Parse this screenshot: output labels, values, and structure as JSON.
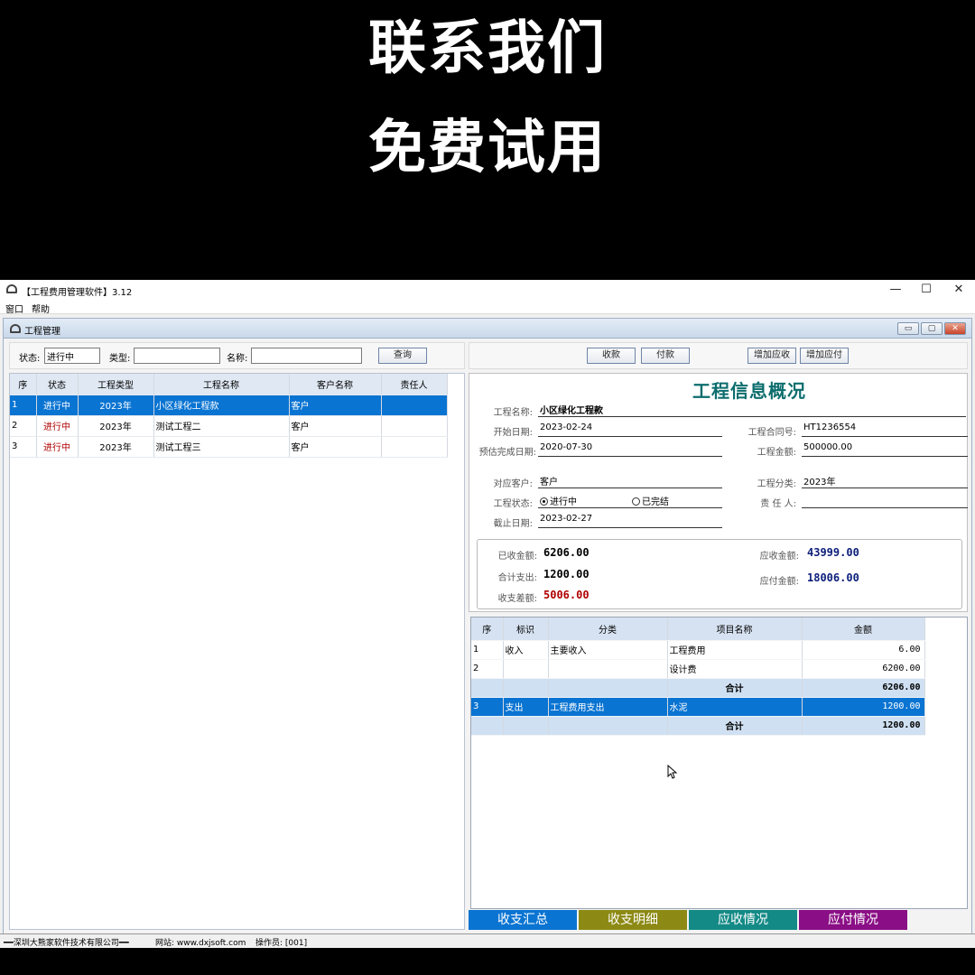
{
  "banner": {
    "line1": "联系我们",
    "line2": "免费试用"
  },
  "window": {
    "title": "【工程费用管理软件】3.12",
    "minimize": "—",
    "maximize": "☐",
    "close": "✕"
  },
  "menu": {
    "items": [
      "窗口",
      "帮助"
    ]
  },
  "child": {
    "title": "工程管理",
    "min": "▭",
    "max": "▢",
    "close": "✕"
  },
  "filter": {
    "status_label": "状态:",
    "status_value": "进行中",
    "type_label": "类型:",
    "type_value": "",
    "name_label": "名称:",
    "name_value": "",
    "query_button": "查询"
  },
  "actions": {
    "receive": "收款",
    "pay": "付款",
    "add_receivable": "增加应收",
    "add_payable": "增加应付"
  },
  "project_grid": {
    "columns": [
      "序",
      "状态",
      "工程类型",
      "工程名称",
      "客户名称",
      "责任人"
    ],
    "rows": [
      {
        "no": "1",
        "status": "进行中",
        "type": "2023年",
        "name": "小区绿化工程款",
        "client": "客户",
        "owner": ""
      },
      {
        "no": "2",
        "status": "进行中",
        "type": "2023年",
        "name": "测试工程二",
        "client": "客户",
        "owner": ""
      },
      {
        "no": "3",
        "status": "进行中",
        "type": "2023年",
        "name": "测试工程三",
        "client": "客户",
        "owner": ""
      }
    ]
  },
  "info": {
    "heading": "工程信息概况",
    "name_label": "工程名称:",
    "name": "小区绿化工程款",
    "start_label": "开始日期:",
    "start": "2023-02-24",
    "contract_label": "工程合同号:",
    "contract": "HT1236554",
    "due_label": "预估完成日期:",
    "due": "2020-07-30",
    "amount_label": "工程金额:",
    "amount": "500000.00",
    "client_label": "对应客户:",
    "client": "客户",
    "category_label": "工程分类:",
    "category": "2023年",
    "state_label": "工程状态:",
    "state_ongoing": "进行中",
    "state_done": "已完结",
    "owner_label": "责 任 人:",
    "owner": "",
    "end_label": "截止日期:",
    "end": "2023-02-27",
    "received_label": "已收金额:",
    "received": "6206.00",
    "receivable_label": "应收金额:",
    "receivable": "43999.00",
    "spent_label": "合计支出:",
    "spent": "1200.00",
    "payable_label": "应付金额:",
    "payable": "18006.00",
    "diff_label": "收支差额:",
    "diff": "5006.00"
  },
  "detail_grid": {
    "columns": [
      "序",
      "标识",
      "分类",
      "项目名称",
      "金额"
    ],
    "rows": [
      {
        "no": "1",
        "tag": "收入",
        "cat": "主要收入",
        "item": "工程费用",
        "amount": "6.00",
        "kind": "row"
      },
      {
        "no": "2",
        "tag": "",
        "cat": "",
        "item": "设计费",
        "amount": "6200.00",
        "kind": "row"
      },
      {
        "no": "",
        "tag": "",
        "cat": "",
        "item": "合计",
        "amount": "6206.00",
        "kind": "total"
      },
      {
        "no": "3",
        "tag": "支出",
        "cat": "工程费用支出",
        "item": "水泥",
        "amount": "1200.00",
        "kind": "sel"
      },
      {
        "no": "",
        "tag": "",
        "cat": "",
        "item": "合计",
        "amount": "1200.00",
        "kind": "total"
      }
    ]
  },
  "tabs": [
    {
      "label": "收支汇总",
      "color": "#0a74d2"
    },
    {
      "label": "收支明细",
      "color": "#8c8a14"
    },
    {
      "label": "应收情况",
      "color": "#138a86"
    },
    {
      "label": "应付情况",
      "color": "#8a0e85"
    }
  ],
  "status": {
    "company": "━━深圳大熊家软件技术有限公司━━",
    "site": "网站: www.dxjsoft.com",
    "operator": "操作员: [001]"
  }
}
